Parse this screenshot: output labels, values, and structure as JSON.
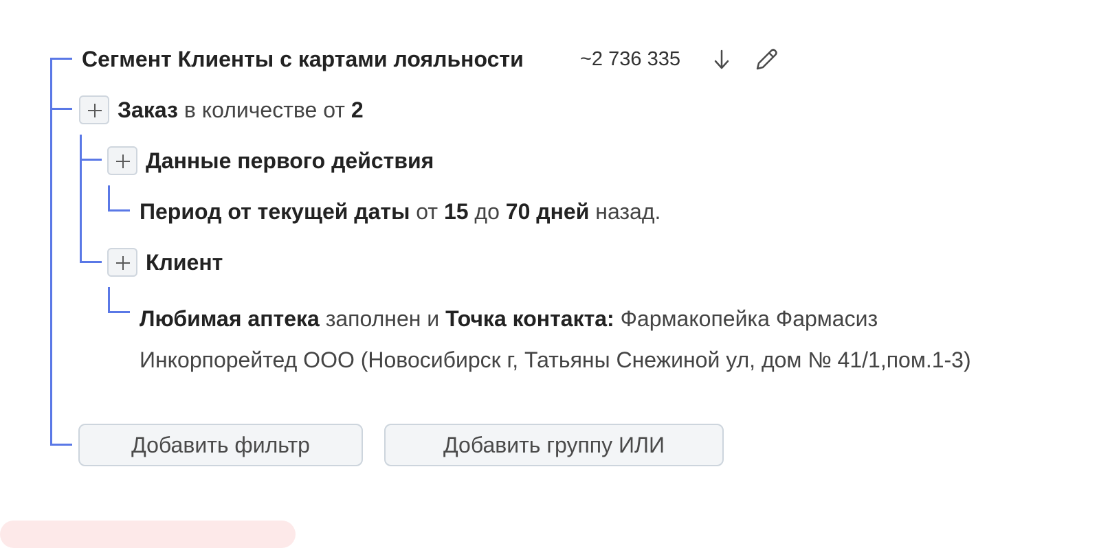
{
  "segment": {
    "title": "Сегмент Клиенты с картами лояльности",
    "count": "~2 736 335",
    "download_icon": "arrow-down-icon",
    "edit_icon": "pencil-icon"
  },
  "filters": {
    "order": {
      "entity": "Заказ",
      "phrase": "в количестве от",
      "value": "2"
    },
    "first_action": {
      "label": "Данные первого действия",
      "period": {
        "label": "Период от текущей даты",
        "from_word": "от",
        "from_value": "15",
        "to_word": "до",
        "to_value": "70 дней",
        "suffix": "назад."
      }
    },
    "client": {
      "label": "Клиент",
      "condition": {
        "field": "Любимая аптека",
        "state": "заполнен",
        "conj": "и",
        "contact_label": "Точка контакта:",
        "contact_value": "Фармакопейка Фармасиз Инкорпорейтед ООО (Новосибирск г, Татьяны Снежиной ул, дом № 41/1,пом.1-3)"
      }
    }
  },
  "actions": {
    "add_filter": "Добавить фильтр",
    "add_or_group": "Добавить группу ИЛИ"
  },
  "colors": {
    "tree_line": "#5a78e6",
    "button_bg": "#f3f5f7",
    "button_border": "#cdd5dd"
  }
}
